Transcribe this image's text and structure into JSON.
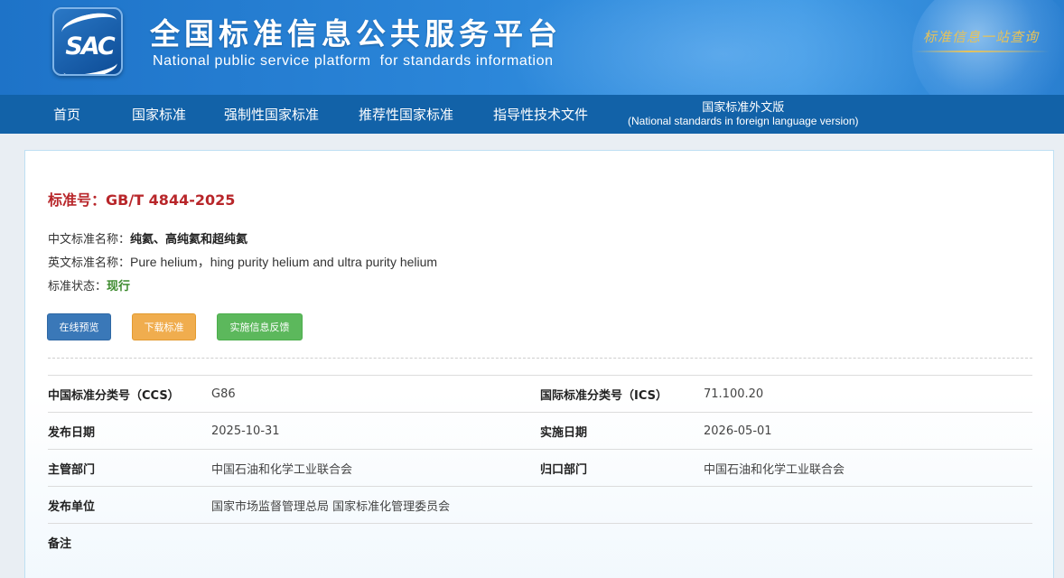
{
  "header": {
    "logo_text": "SAC",
    "title": "全国标准信息公共服务平台",
    "subtitle": "National public service platform  for standards information",
    "slogan": "标准信息一站查询"
  },
  "nav": {
    "items": [
      {
        "label": "首页"
      },
      {
        "label": "国家标准"
      },
      {
        "label": "强制性国家标准"
      },
      {
        "label": "推荐性国家标准"
      },
      {
        "label": "指导性技术文件"
      }
    ],
    "foreign": {
      "label": "国家标准外文版",
      "sublabel": "(National standards in foreign language version)"
    }
  },
  "standard": {
    "number_label": "标准号：",
    "number": "GB/T 4844-2025",
    "cn_name_label": "中文标准名称：",
    "cn_name": "纯氦、高纯氦和超纯氦",
    "en_name_label": "英文标准名称：",
    "en_name": "Pure helium，hing purity helium and ultra purity helium",
    "status_label": "标准状态：",
    "status": "现行"
  },
  "actions": {
    "preview": "在线预览",
    "download": "下载标准",
    "feedback": "实施信息反馈"
  },
  "meta": {
    "rows": [
      {
        "label1": "中国标准分类号（CCS）",
        "value1": "G86",
        "label2": "国际标准分类号（ICS）",
        "value2": "71.100.20"
      },
      {
        "label1": "发布日期",
        "value1": "2025-10-31",
        "label2": "实施日期",
        "value2": "2026-05-01"
      },
      {
        "label1": "主管部门",
        "value1": "中国石油和化学工业联合会",
        "label2": "归口部门",
        "value2": "中国石油和化学工业联合会"
      },
      {
        "label1": "发布单位",
        "value1": "国家市场监督管理总局 国家标准化管理委员会",
        "label2": "",
        "value2": ""
      },
      {
        "label1": "备注",
        "value1": "",
        "label2": "",
        "value2": ""
      }
    ]
  },
  "colors": {
    "banner": "#2b86d9",
    "nav": "#1262a8",
    "std_number": "#b8262a",
    "status": "#3d8a2e",
    "btn_preview": "#3a78b8",
    "btn_download": "#f0ad4e",
    "btn_feedback": "#5cb85c"
  }
}
